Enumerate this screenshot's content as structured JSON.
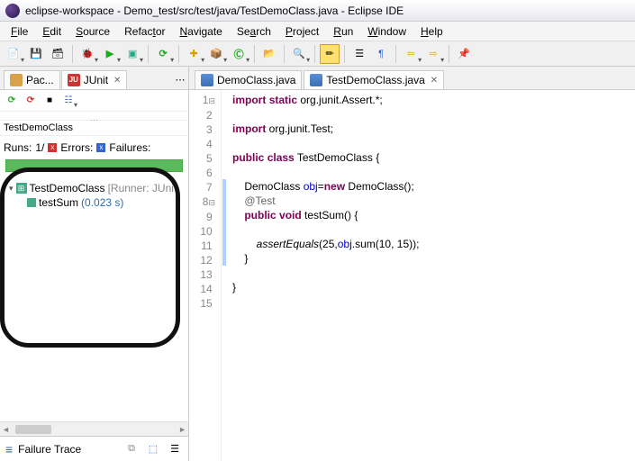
{
  "title": "eclipse-workspace - Demo_test/src/test/java/TestDemoClass.java - Eclipse IDE",
  "menu": [
    "File",
    "Edit",
    "Source",
    "Refactor",
    "Navigate",
    "Search",
    "Project",
    "Run",
    "Window",
    "Help"
  ],
  "leftTabs": [
    {
      "label": "Pac...",
      "icon": "pkg"
    },
    {
      "label": "JUnit",
      "icon": "junit",
      "active": true,
      "closable": true
    }
  ],
  "junit": {
    "className": "TestDemoClass",
    "runs": "1/",
    "errorsLabel": "Errors:",
    "failuresLabel": "Failures:",
    "runsLabel": "Runs:",
    "tree": {
      "root": {
        "label": "TestDemoClass",
        "runner": "[Runner: JUni"
      },
      "child": {
        "label": "testSum",
        "duration": "(0.023 s)"
      }
    },
    "failureTrace": "Failure Trace"
  },
  "editorTabs": [
    {
      "label": "DemoClass.java",
      "active": false
    },
    {
      "label": "TestDemoClass.java",
      "active": true,
      "closable": true
    }
  ],
  "code": {
    "lines": [
      {
        "n": "1",
        "fold": "⊟",
        "html": "<span class='kw'>import</span> <span class='kw'>static</span> org.junit.Assert.*;"
      },
      {
        "n": "2",
        "html": ""
      },
      {
        "n": "3",
        "html": "<span class='kw'>import</span> org.junit.Test;"
      },
      {
        "n": "4",
        "html": ""
      },
      {
        "n": "5",
        "html": "<span class='kw'>public</span> <span class='kw'>class</span> TestDemoClass {"
      },
      {
        "n": "6",
        "html": ""
      },
      {
        "n": "7",
        "html": "    DemoClass <span class='field'>obj</span>=<span class='kw'>new</span> DemoClass();"
      },
      {
        "n": "8",
        "fold": "⊟",
        "html": "    <span class='ann'>@Test</span>"
      },
      {
        "n": "9",
        "html": "    <span class='kw'>public</span> <span class='kw'>void</span> testSum() {"
      },
      {
        "n": "10",
        "html": ""
      },
      {
        "n": "11",
        "html": "        <span class='meth-i'>assertEquals</span>(25,<span class='field'>obj</span>.sum(10, 15));"
      },
      {
        "n": "12",
        "html": "    }",
        "cur": true
      },
      {
        "n": "13",
        "html": ""
      },
      {
        "n": "14",
        "html": "}"
      },
      {
        "n": "15",
        "html": ""
      }
    ]
  }
}
